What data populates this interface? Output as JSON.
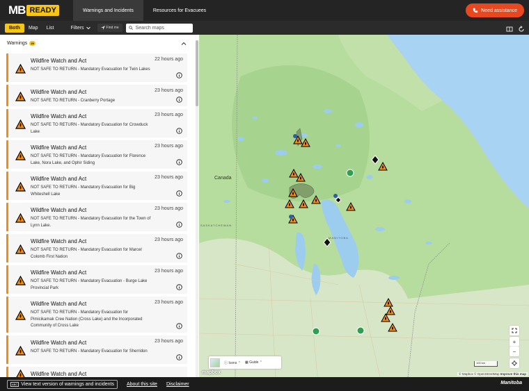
{
  "header": {
    "logo_mb": "MB",
    "logo_ready": "READY",
    "tabs": [
      {
        "label": "Warnings and Incidents",
        "active": true
      },
      {
        "label": "Resources for Evacuees",
        "active": false
      }
    ],
    "assist_label": "Need assistance",
    "accent": "#e8481f"
  },
  "toolbar": {
    "view_options": [
      "Both",
      "Map",
      "List"
    ],
    "selected_view": "Both",
    "filters_label": "Filters",
    "findme_label": "Find me",
    "search_placeholder": "Search maps"
  },
  "panel": {
    "heading": "Warnings",
    "count": "29",
    "warnings": [
      {
        "title": "Wildfire Watch and Act",
        "time": "22 hours ago",
        "desc": "NOT SAFE TO RETURN - Mandatory Evacuation for Twin Lakes"
      },
      {
        "title": "Wildfire Watch and Act",
        "time": "23 hours ago",
        "desc": "NOT SAFE TO RETURN - Cranberry Portage"
      },
      {
        "title": "Wildfire Watch and Act",
        "time": "23 hours ago",
        "desc": "NOT SAFE TO RETURN - Mandatory Evacuation for Crowduck Lake"
      },
      {
        "title": "Wildfire Watch and Act",
        "time": "23 hours ago",
        "desc": "NOT SAFE TO RETURN - Mandatory Evacuation for Florence Lake, Nora Lake, and Ophir Siding"
      },
      {
        "title": "Wildfire Watch and Act",
        "time": "23 hours ago",
        "desc": "NOT SAFE TO RETURN - Mandatory Evacuation for Big Whiteshell Lake"
      },
      {
        "title": "Wildfire Watch and Act",
        "time": "23 hours ago",
        "desc": "NOT SAFE TO RETURN - Mandatory Evacuation for the Town of Lynn Lake."
      },
      {
        "title": "Wildfire Watch and Act",
        "time": "23 hours ago",
        "desc": "NOT SAFE TO RETURN - Mandatory Evacuation for Marcel Colomb First Nation"
      },
      {
        "title": "Wildfire Watch and Act",
        "time": "23 hours ago",
        "desc": "NOT SAFE TO RETURN - Mandatory Evacuation - Burge Lake Provincial Park"
      },
      {
        "title": "Wildfire Watch and Act",
        "time": "23 hours ago",
        "desc": "NOT SAFE TO RETURN - Mandatory Evacuation for Pimicikamak Cree Nation (Cross Lake) and the Incorporated Community of Cross Lake"
      },
      {
        "title": "Wildfire Watch and Act",
        "time": "23 hours ago",
        "desc": "NOT SAFE TO RETURN - Mandatory Evacuation for Sherridon"
      },
      {
        "title": "Wildfire Watch and Act",
        "time": "",
        "desc": ""
      }
    ],
    "warning_color": "#f08c1a"
  },
  "map": {
    "labels": {
      "canada": "Canada",
      "saskatchewan": "SASKATCHEWAN",
      "manitoba": "MANITOBA"
    },
    "legend_icons_label": "Icons",
    "legend_guide_label": "Guide",
    "scale_label": "100 km",
    "attribution": "© Mapbox © OpenStreetMap",
    "improve_label": "Improve this map",
    "mapbox_label": "mapbox"
  },
  "footer": {
    "text_version_label": "View text version of warnings and incidents",
    "kbd_label": "ABC",
    "about_label": "About this site",
    "disclaimer_label": "Disclaimer",
    "gov_label": "Manitoba"
  }
}
